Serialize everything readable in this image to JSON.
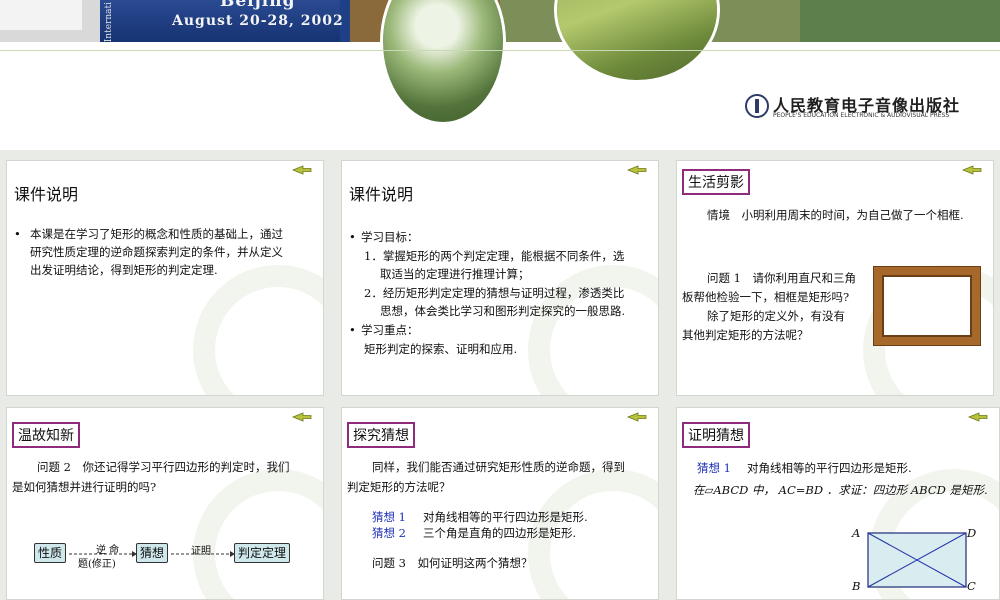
{
  "banner": {
    "side_text": "Internati",
    "city": "Beijing",
    "date": "August 20-28, 2002",
    "publisher_cn": "人民教育电子音像出版社",
    "publisher_en": "PEOPLE'S EDUCATION ELECTRONIC & AUDIOVISUAL PRESS"
  },
  "colors": {
    "heading_border": "#8e2b7c",
    "guess_blue": "#1f32b8",
    "flow_fill": "#cfe8ec",
    "frame_wood": "#a7682c"
  },
  "slides": {
    "s1": {
      "heading": "课件说明",
      "bullet": "•",
      "lines": [
        "本课是在学习了矩形的概念和性质的基础上，通过",
        "研究性质定理的逆命题探索判定的条件，并从定义",
        "出发证明结论，得到矩形的判定定理."
      ]
    },
    "s2": {
      "heading": "课件说明",
      "bullet1": "•",
      "goal_label": "学习目标：",
      "goal1": [
        "1．掌握矩形的两个判定定理，能根据不同条件，选",
        "取适当的定理进行推理计算；"
      ],
      "goal2": [
        "2．经历矩形判定定理的猜想与证明过程，渗透类比",
        "思想，体会类比学习和图形判定探究的一般思路."
      ],
      "bullet2": "•",
      "key_label": "学习重点：",
      "key_text": "矩形判定的探索、证明和应用."
    },
    "s3": {
      "heading": "生活剪影",
      "scene": "情境　小明利用周末的时间，为自己做了一个相框.",
      "question": [
        "问题 1　请你利用直尺和三角",
        "板帮他检验一下，相框是矩形吗?",
        "除了矩形的定义外，有没有",
        "其他判定矩形的方法呢？"
      ]
    },
    "s4": {
      "heading": "温故知新",
      "question": [
        "问题 2　你还记得学习平行四边形的判定时，我们",
        "是如何猜想并进行证明的吗?"
      ],
      "flow": {
        "box1": "性质",
        "label1": "逆 命",
        "label1b": "题(修正)",
        "box2": "猜想",
        "label2": "证明",
        "box3": "判定定理"
      }
    },
    "s5": {
      "heading": "探究猜想",
      "intro": [
        "同样，我们能否通过研究矩形性质的逆命题，得到",
        "判定矩形的方法呢？"
      ],
      "guess1_label": "猜想 1",
      "guess1_text": "对角线相等的平行四边形是矩形.",
      "guess2_label": "猜想 2",
      "guess2_text": "三个角是直角的四边形是矩形.",
      "question3": "问题 3　如何证明这两个猜想？"
    },
    "s6": {
      "heading": "证明猜想",
      "guess1_label": "猜想 1",
      "guess1_text": "对角线相等的平行四边形是矩形.",
      "given": "在▱ABCD 中，  AC=BD ．求证：四边形 ABCD 是矩形.",
      "vertices": {
        "a": "A",
        "b": "B",
        "c": "C",
        "d": "D"
      }
    }
  }
}
